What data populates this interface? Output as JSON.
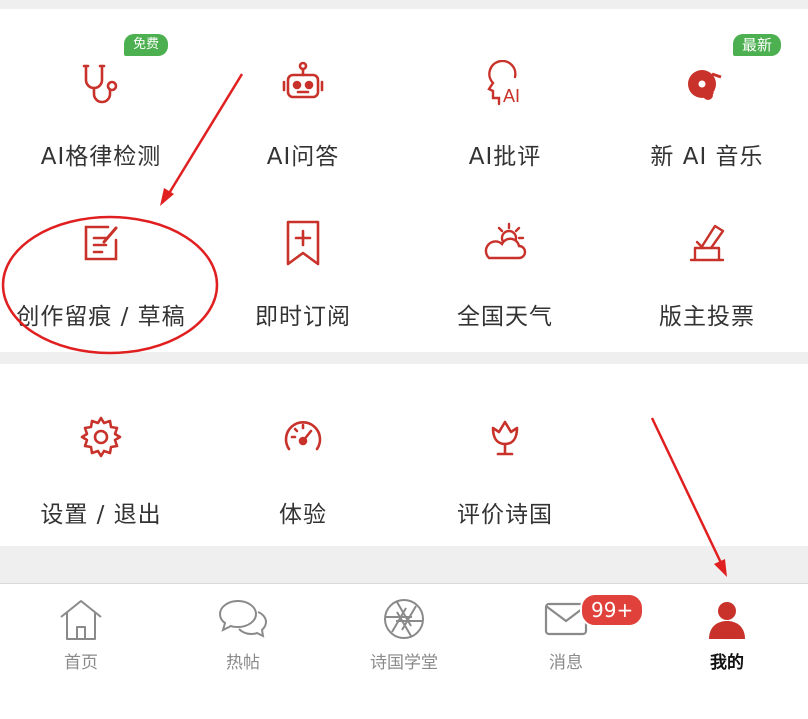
{
  "colors": {
    "accent": "#c8322a",
    "badge_green": "#4caf50",
    "text": "#333333",
    "tab_inactive": "#8a8a8a",
    "annotation": "#e02020"
  },
  "grid": {
    "items": [
      {
        "label": "AI格律检测",
        "icon": "stethoscope-icon",
        "badge": "免费"
      },
      {
        "label": "AI问答",
        "icon": "robot-icon",
        "badge": ""
      },
      {
        "label": "AI批评",
        "icon": "ai-head-icon",
        "badge": ""
      },
      {
        "label": "新 AI 音乐",
        "icon": "music-disc-icon",
        "badge": "最新"
      },
      {
        "label": "创作留痕 / 草稿",
        "icon": "edit-note-icon",
        "badge": ""
      },
      {
        "label": "即时订阅",
        "icon": "bookmark-plus-icon",
        "badge": ""
      },
      {
        "label": "全国天气",
        "icon": "weather-icon",
        "badge": ""
      },
      {
        "label": "版主投票",
        "icon": "vote-box-icon",
        "badge": ""
      }
    ]
  },
  "more": {
    "items": [
      {
        "label": "设置 / 退出",
        "icon": "gear-icon"
      },
      {
        "label": "体验",
        "icon": "speedometer-icon"
      },
      {
        "label": "评价诗国",
        "icon": "lotus-icon"
      }
    ]
  },
  "tabbar": {
    "tabs": [
      {
        "label": "首页",
        "icon": "home-icon"
      },
      {
        "label": "热帖",
        "icon": "chat-bubbles-icon"
      },
      {
        "label": "诗国学堂",
        "icon": "aperture-icon"
      },
      {
        "label": "消息",
        "icon": "envelope-icon"
      },
      {
        "label": "我的",
        "icon": "user-icon",
        "active": true
      }
    ],
    "message_count": "99+"
  }
}
